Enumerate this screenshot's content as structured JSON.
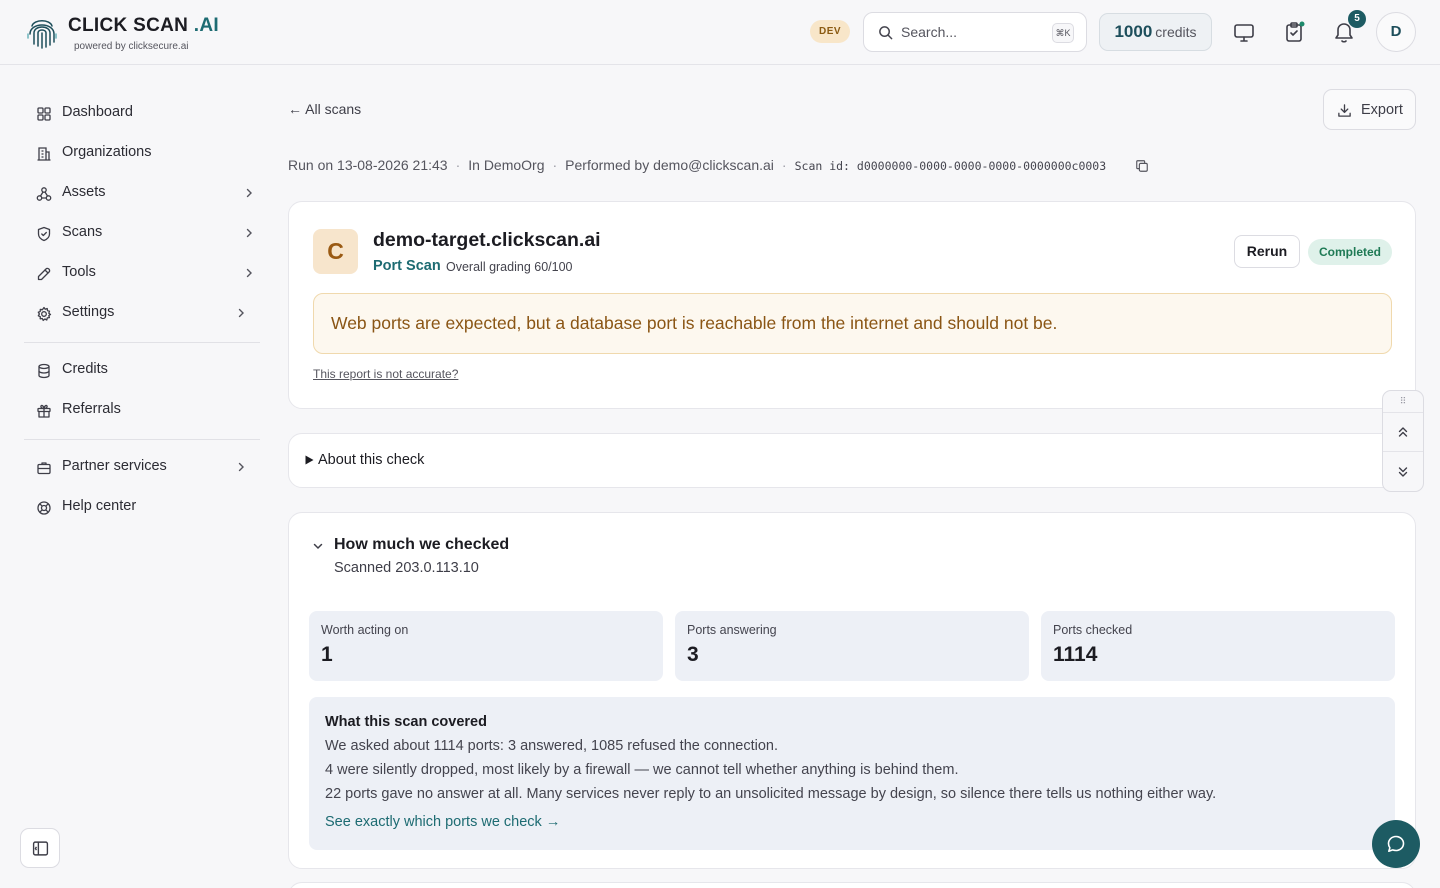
{
  "header": {
    "brand_name": "CLICK SCAN",
    "brand_suffix": " .AI",
    "brand_sub": "powered by clicksecure.ai",
    "env_badge": "DEV",
    "search_placeholder": "Search...",
    "search_shortcut": "⌘K",
    "credits_value": "1000",
    "credits_label": "credits",
    "notification_count": "5",
    "avatar_initial": "D",
    "colors": {
      "brand_accent": "#1d6b72",
      "badge_dark": "#1d5b63"
    }
  },
  "sidebar": {
    "items": [
      {
        "label": "Dashboard",
        "icon": "grid-icon"
      },
      {
        "label": "Organizations",
        "icon": "building-icon"
      },
      {
        "label": "Assets",
        "icon": "network-icon"
      },
      {
        "label": "Scans",
        "icon": "shield-icon"
      },
      {
        "label": "Tools",
        "icon": "wrench-icon"
      },
      {
        "label": "Settings",
        "icon": "gear-icon"
      },
      {
        "label": "Credits",
        "icon": "database-icon"
      },
      {
        "label": "Referrals",
        "icon": "gift-icon"
      },
      {
        "label": "Partner services",
        "icon": "briefcase-icon"
      },
      {
        "label": "Help center",
        "icon": "lifebuoy-icon"
      }
    ]
  },
  "main": {
    "back_link": "← All scans",
    "export_label": "Export",
    "meta": {
      "run": "Run on 13-08-2026 21:43",
      "org": "In DemoOrg",
      "performer": "Performed by demo@clickscan.ai",
      "scan_id": "Scan id: d0000000-0000-0000-0000-0000000c0003"
    },
    "result": {
      "grade": "C",
      "target": "demo-target.clickscan.ai",
      "scan_type": "Port Scan",
      "grading": "Overall grading 60/100",
      "rerun_label": "Rerun",
      "status": "Completed",
      "summary": "Web ports are expected, but a database port is reachable from the internet and should not be.",
      "report_link": "This report is not accurate?"
    },
    "about": {
      "label": "About this check"
    },
    "checked": {
      "title": "How much we checked",
      "subtitle": "Scanned 203.0.113.10",
      "stats": [
        {
          "label": "Worth acting on",
          "value": "1"
        },
        {
          "label": "Ports answering",
          "value": "3"
        },
        {
          "label": "Ports checked",
          "value": "1114"
        }
      ],
      "covered": {
        "title": "What this scan covered",
        "lines": [
          "We asked about 1114 ports: 3 answered, 1085 refused the connection.",
          "4 were silently dropped, most likely by a firewall — we cannot tell whether anything is behind them.",
          "22 ports gave no answer at all. Many services never reply to an unsolicited message by design, so silence there tells us nothing either way."
        ],
        "link": "See exactly which ports we check →"
      }
    }
  }
}
